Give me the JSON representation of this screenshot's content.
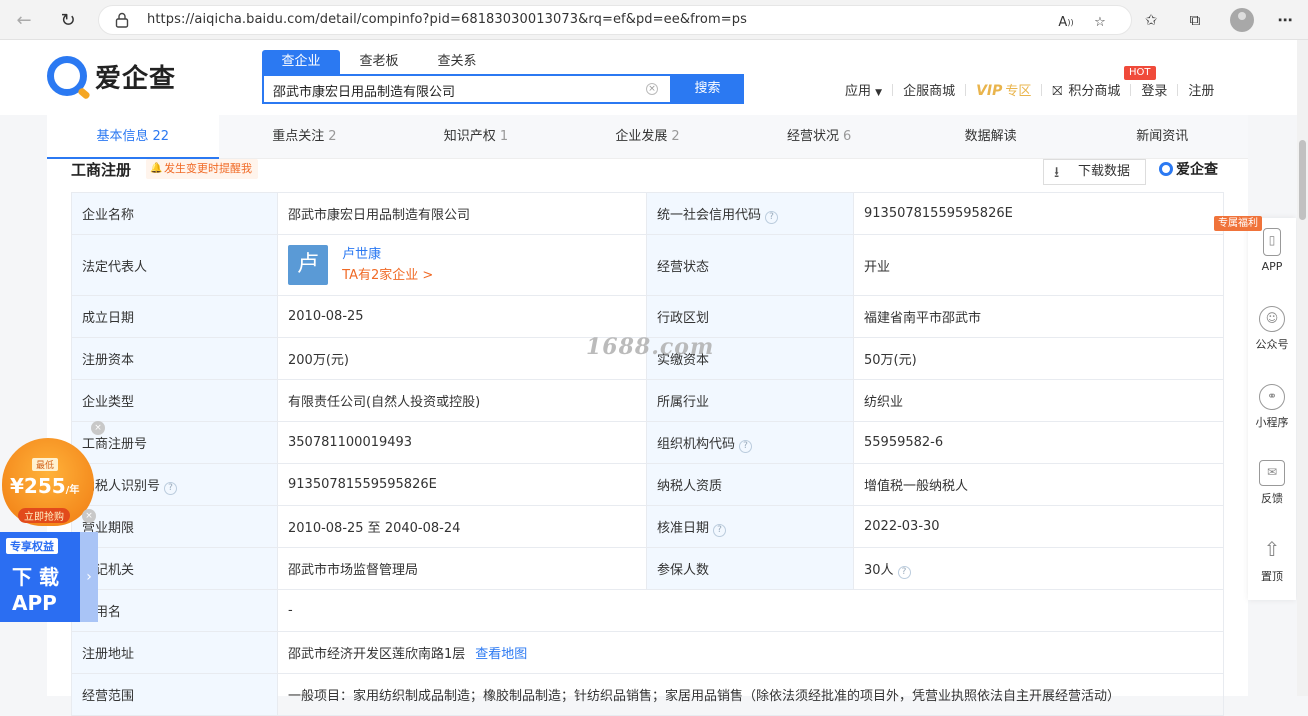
{
  "browser": {
    "url": "https://aiqicha.baidu.com/detail/compinfo?pid=68183030013073&rq=ef&pd=ee&from=ps"
  },
  "site": {
    "logo_text": "爱企查",
    "search_tabs": [
      "查企业",
      "查老板",
      "查关系"
    ],
    "search_query": "邵武市康宏日用品制造有限公司",
    "search_button": "搜索",
    "nav": {
      "apps": "应用",
      "mall": "企服商城",
      "vip": "VIP",
      "vip_sub": "专区",
      "points": "积分商城",
      "hot": "HOT",
      "login": "登录",
      "register": "注册"
    }
  },
  "tabs": [
    {
      "label": "基本信息",
      "count": "22"
    },
    {
      "label": "重点关注",
      "count": "2"
    },
    {
      "label": "知识产权",
      "count": "1"
    },
    {
      "label": "企业发展",
      "count": "2"
    },
    {
      "label": "经营状况",
      "count": "6"
    },
    {
      "label": "数据解读",
      "count": ""
    },
    {
      "label": "新闻资讯",
      "count": ""
    }
  ],
  "section": {
    "title": "工商注册",
    "remind": "发生变更时提醒我",
    "download": "下载数据",
    "brand": "爱企查"
  },
  "info": {
    "name_k": "企业名称",
    "name_v": "邵武市康宏日用品制造有限公司",
    "credit_k": "统一社会信用代码",
    "credit_v": "91350781559595826E",
    "legal_k": "法定代表人",
    "legal_avatar": "卢",
    "legal_name": "卢世康",
    "legal_more": "TA有2家企业 >",
    "status_k": "经营状态",
    "status_v": "开业",
    "found_k": "成立日期",
    "found_v": "2010-08-25",
    "region_k": "行政区划",
    "region_v": "福建省南平市邵武市",
    "capital_k": "注册资本",
    "capital_v": "200万(元)",
    "paid_k": "实缴资本",
    "paid_v": "50万(元)",
    "type_k": "企业类型",
    "type_v": "有限责任公司(自然人投资或控股)",
    "industry_k": "所属行业",
    "industry_v": "纺织业",
    "regno_k": "工商注册号",
    "regno_v": "350781100019493",
    "orgcode_k": "组织机构代码",
    "orgcode_v": "55959582-6",
    "tax_k": "纳税人识别号",
    "tax_v": "91350781559595826E",
    "taxq_k": "纳税人资质",
    "taxq_v": "增值税一般纳税人",
    "term_k": "营业期限",
    "term_v": "2010-08-25 至 2040-08-24",
    "approve_k": "核准日期",
    "approve_v": "2022-03-30",
    "authority_k": "登记机关",
    "authority_v": "邵武市市场监督管理局",
    "insured_k": "参保人数",
    "insured_v": "30人",
    "former_k": "曾用名",
    "former_v": "-",
    "address_k": "注册地址",
    "address_v": "邵武市经济开发区莲欣南路1层",
    "address_link": "查看地图",
    "scope_k": "经营范围",
    "scope_v": "一般项目：家用纺织制成品制造；橡胶制品制造；针纺织品销售；家居用品销售（除依法须经批准的项目外，凭营业执照依法自主开展经营活动）"
  },
  "watermark": "1688.com",
  "right_bar": {
    "perk": "专属福利",
    "items": [
      "APP",
      "公众号",
      "小程序",
      "反馈",
      "置顶"
    ]
  },
  "promo": {
    "low": "最低",
    "price": "¥255",
    "unit": "/年",
    "grab": "立即抢购",
    "tag": "专享权益",
    "line1": "下 载",
    "line2": "APP"
  }
}
